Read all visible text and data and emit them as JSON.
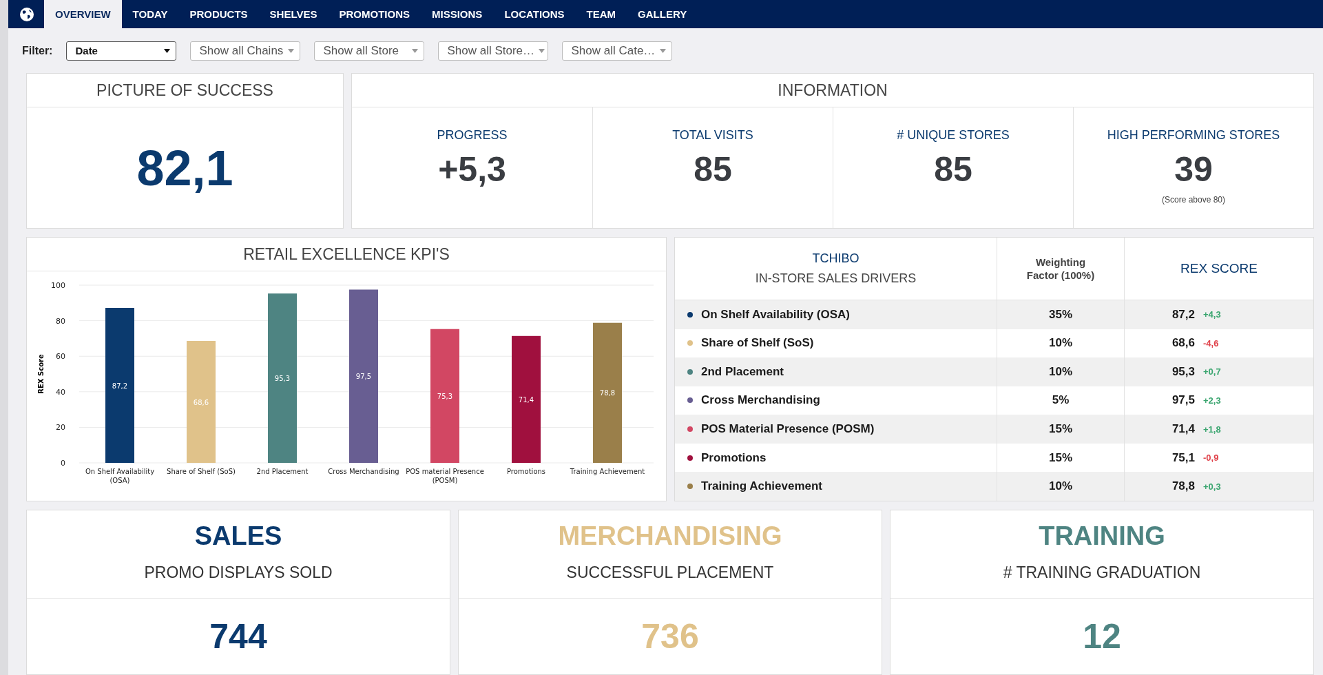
{
  "nav": {
    "tabs": [
      {
        "label": "OVERVIEW",
        "selected": true
      },
      {
        "label": "TODAY",
        "selected": false
      },
      {
        "label": "PRODUCTS",
        "selected": false
      },
      {
        "label": "SHELVES",
        "selected": false
      },
      {
        "label": "PROMOTIONS",
        "selected": false
      },
      {
        "label": "MISSIONS",
        "selected": false
      },
      {
        "label": "LOCATIONS",
        "selected": false
      },
      {
        "label": "TEAM",
        "selected": false
      },
      {
        "label": "GALLERY",
        "selected": false
      }
    ]
  },
  "filter": {
    "label": "Filter:",
    "dropdowns": [
      {
        "value": "Date",
        "active": true
      },
      {
        "value": "Show all Chains",
        "active": false
      },
      {
        "value": "Show all Store",
        "active": false
      },
      {
        "value": "Show all Store…",
        "active": false
      },
      {
        "value": "Show all Cate…",
        "active": false
      }
    ]
  },
  "picture_of_success": {
    "title": "PICTURE OF SUCCESS",
    "value": "82,1"
  },
  "information": {
    "title": "INFORMATION",
    "metrics": [
      {
        "label": "PROGRESS",
        "value": "+5,3"
      },
      {
        "label": "TOTAL VISITS",
        "value": "85"
      },
      {
        "label": "# UNIQUE STORES",
        "value": "85"
      },
      {
        "label": "HIGH PERFORMING STORES",
        "value": "39",
        "note": "(Score above 80)"
      }
    ]
  },
  "kpi_chart": {
    "title": "RETAIL EXCELLENCE KPI'S",
    "chart_data": {
      "type": "bar",
      "ylabel": "REX Score",
      "ylim": [
        0,
        100
      ],
      "grid": true,
      "yticks": [
        0,
        20,
        40,
        60,
        80,
        100
      ],
      "data_labels": true,
      "categories": [
        "On Shelf Availability (OSA)",
        "Share of Shelf (SoS)",
        "2nd Placement",
        "Cross Merchandising",
        "POS material Presence (POSM)",
        "Promotions",
        "Training Achievement"
      ],
      "series": [
        {
          "colors": [
            "#0b3a6e",
            "#e0c28a",
            "#4e8482",
            "#685e92",
            "#d24763",
            "#a0103e",
            "#9a7f4a"
          ],
          "values": [
            87.2,
            68.6,
            95.3,
            97.5,
            75.3,
            71.4,
            78.8
          ],
          "value_labels": [
            "87,2",
            "68,6",
            "95,3",
            "97,5",
            "75,3",
            "71,4",
            "78,8"
          ]
        }
      ]
    }
  },
  "drivers_table": {
    "brand": "TCHIBO",
    "title": "IN-STORE SALES DRIVERS",
    "weighting_header": "Weighting Factor (100%)",
    "score_header": "REX SCORE",
    "rows": [
      {
        "name": "On Shelf Availability (OSA)",
        "color": "#0b3a6e",
        "weight": "35%",
        "score": "87,2",
        "delta": "+4,3",
        "positive": true
      },
      {
        "name": "Share of Shelf (SoS)",
        "color": "#e0c28a",
        "weight": "10%",
        "score": "68,6",
        "delta": "-4,6",
        "positive": false
      },
      {
        "name": "2nd Placement",
        "color": "#4e8482",
        "weight": "10%",
        "score": "95,3",
        "delta": "+0,7",
        "positive": true
      },
      {
        "name": "Cross Merchandising",
        "color": "#685e92",
        "weight": "5%",
        "score": "97,5",
        "delta": "+2,3",
        "positive": true
      },
      {
        "name": "POS Material Presence (POSM)",
        "color": "#d24763",
        "weight": "15%",
        "score": "71,4",
        "delta": "+1,8",
        "positive": true
      },
      {
        "name": "Promotions",
        "color": "#a0103e",
        "weight": "15%",
        "score": "75,1",
        "delta": "-0,9",
        "positive": false
      },
      {
        "name": "Training Achievement",
        "color": "#9a7f4a",
        "weight": "10%",
        "score": "78,8",
        "delta": "+0,3",
        "positive": true
      }
    ]
  },
  "summary_cards": [
    {
      "title": "SALES",
      "color": "#0b3a6e",
      "subtitle": "PROMO DISPLAYS SOLD",
      "value": "744"
    },
    {
      "title": "MERCHANDISING",
      "color": "#e0c28a",
      "subtitle": "SUCCESSFUL PLACEMENT",
      "value": "736"
    },
    {
      "title": "TRAINING",
      "color": "#4e8482",
      "subtitle": "# TRAINING GRADUATION",
      "value": "12"
    }
  ]
}
